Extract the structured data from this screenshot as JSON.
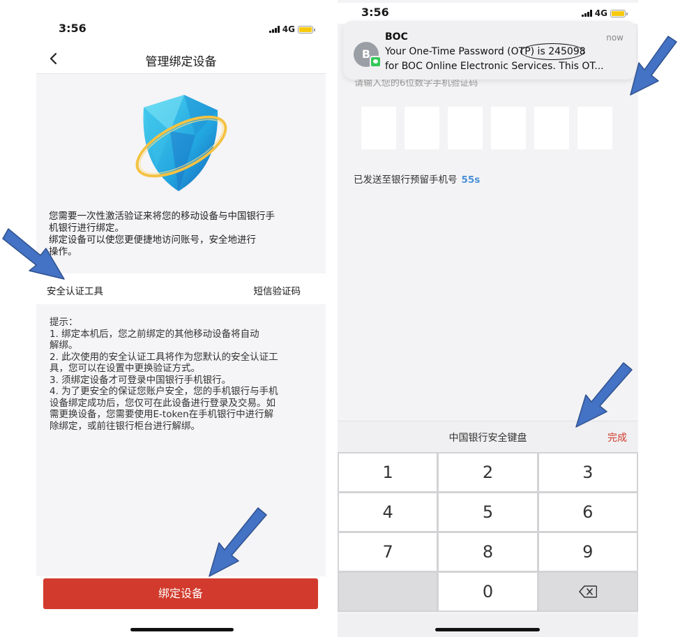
{
  "left_screen": {
    "status": {
      "time": "3:56",
      "network": "4G"
    },
    "nav": {
      "title": "管理绑定设备",
      "back_icon": "chevron-left-icon"
    },
    "hero_icon": "shield-icon",
    "intro_lines": [
      "您需要一次性激活验证来将您的移动设备与中国银行手",
      "机银行进行绑定。",
      "绑定设备可以使您更便捷地访问账号，安全地进行",
      "操作。"
    ],
    "security_tool": {
      "label": "安全认证工具",
      "value": "短信验证码"
    },
    "tips": [
      "提示：",
      "1. 绑定本机后，您之前绑定的其他移动设备将自动",
      "解绑。",
      "2. 此次使用的安全认证工具将作为您默认的安全认证工",
      "具，您可以在设置中更换验证方式。",
      "3. 须绑定设备才可登录中国银行手机银行。",
      "4. 为了更安全的保证您账户安全，您的手机银行与手机",
      "设备绑定成功后，您仅可在此设备进行登录及交易。如",
      "需更换设备，您需要使用E-token在手机银行中进行解",
      "除绑定，或前往银行柜台进行解绑。"
    ],
    "bind_button": "绑定设备"
  },
  "right_screen": {
    "status": {
      "time": "3:56",
      "network": "4G"
    },
    "notification": {
      "avatar_letter": "B",
      "app_icon": "messages-icon",
      "sender": "BOC",
      "time": "now",
      "line1_prefix": "Your One-Time Password (OTP) is ",
      "otp": "245098",
      "line2": "for BOC Online Electronic Services. This OT..."
    },
    "prompt_obscured": "请输入您的6位数字手机验证码",
    "code_boxes": [
      "",
      "",
      "",
      "",
      "",
      ""
    ],
    "sent_to": "已发送至银行预留手机号",
    "countdown": "55s",
    "keyboard": {
      "title": "中国银行安全键盘",
      "done": "完成",
      "keys": [
        "1",
        "2",
        "3",
        "4",
        "5",
        "6",
        "7",
        "8",
        "9",
        "",
        "0",
        ""
      ],
      "delete_icon": "backspace-icon"
    }
  },
  "annotation_arrows": [
    "arrow-icon",
    "arrow-icon",
    "arrow-icon",
    "arrow-icon"
  ],
  "colors": {
    "brand_red": "#d13a2c",
    "arrow_blue": "#4472c4",
    "timer_blue": "#4a90d9",
    "imessage_green": "#34c759"
  }
}
